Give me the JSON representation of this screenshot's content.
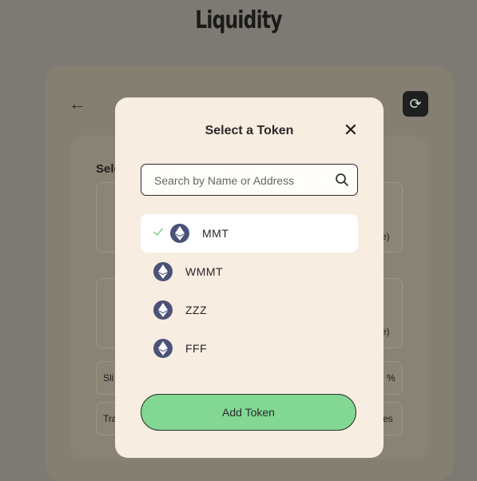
{
  "page": {
    "title": "Liquidity"
  },
  "background": {
    "select_label": "Sele",
    "slippage_label": "Sli",
    "slippage_suffix": "%",
    "transaction_label": "Tra",
    "transaction_suffix": "es",
    "balance_suffix_1": "e)",
    "balance_suffix_2": "e)"
  },
  "modal": {
    "title": "Select a Token",
    "search_placeholder": "Search by Name or Address",
    "tokens": [
      {
        "symbol": "MMT",
        "selected": true
      },
      {
        "symbol": "WMMT",
        "selected": false
      },
      {
        "symbol": "ZZZ",
        "selected": false
      },
      {
        "symbol": "FFF",
        "selected": false
      }
    ],
    "add_button_label": "Add Token"
  },
  "colors": {
    "modal_bg": "#f7ede0",
    "add_button": "#82d893",
    "token_icon": "#4b5278",
    "check": "#7fd18c"
  }
}
